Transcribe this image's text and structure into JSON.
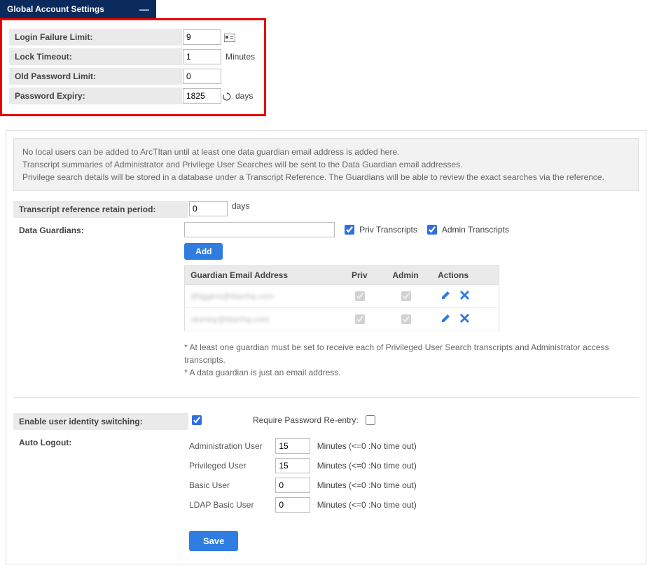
{
  "header": {
    "title": "Global Account Settings"
  },
  "top_settings": {
    "login_failure_limit_label": "Login Failure Limit:",
    "login_failure_limit_value": "9",
    "lock_timeout_label": "Lock Timeout:",
    "lock_timeout_value": "1",
    "lock_timeout_unit": "Minutes",
    "old_password_limit_label": "Old Password Limit:",
    "old_password_limit_value": "0",
    "password_expiry_label": "Password Expiry:",
    "password_expiry_value": "1825",
    "password_expiry_unit": "days"
  },
  "info": {
    "line1": "No local users can be added to ArcTItan until at least one data guardian email address is added here.",
    "line2": "Transcript summaries of Administrator and Privilege User Searches will be sent to the Data Guardian email addresses.",
    "line3": "Privilege search details will be stored in a database under a Transcript Reference. The Guardians will be able to review the exact searches via the reference."
  },
  "transcript": {
    "retain_label": "Transcript reference retain period:",
    "retain_value": "0",
    "retain_unit": "days"
  },
  "guardians": {
    "label": "Data Guardians:",
    "priv_label": "Priv Transcripts",
    "admin_label": "Admin Transcripts",
    "add_button": "Add",
    "table_headers": {
      "email": "Guardian Email Address",
      "priv": "Priv",
      "admin": "Admin",
      "actions": "Actions"
    },
    "rows": [
      {
        "email": "dhiggins@titanhq.com"
      },
      {
        "email": "skenny@titanhq.com"
      }
    ],
    "footnote1": "* At least one guardian must be set to receive each of Privileged User Search transcripts and Administrator access transcripts.",
    "footnote2": "* A data guardian is just an email address."
  },
  "identity": {
    "enable_label": "Enable user identity switching:",
    "require_label": "Require Password Re-entry:"
  },
  "auto_logout": {
    "label": "Auto Logout:",
    "hint": "Minutes (<=0 :No time out)",
    "rows": [
      {
        "label": "Administration User",
        "value": "15"
      },
      {
        "label": "Privileged User",
        "value": "15"
      },
      {
        "label": "Basic User",
        "value": "0"
      },
      {
        "label": "LDAP Basic User",
        "value": "0"
      }
    ]
  },
  "save_button": "Save"
}
